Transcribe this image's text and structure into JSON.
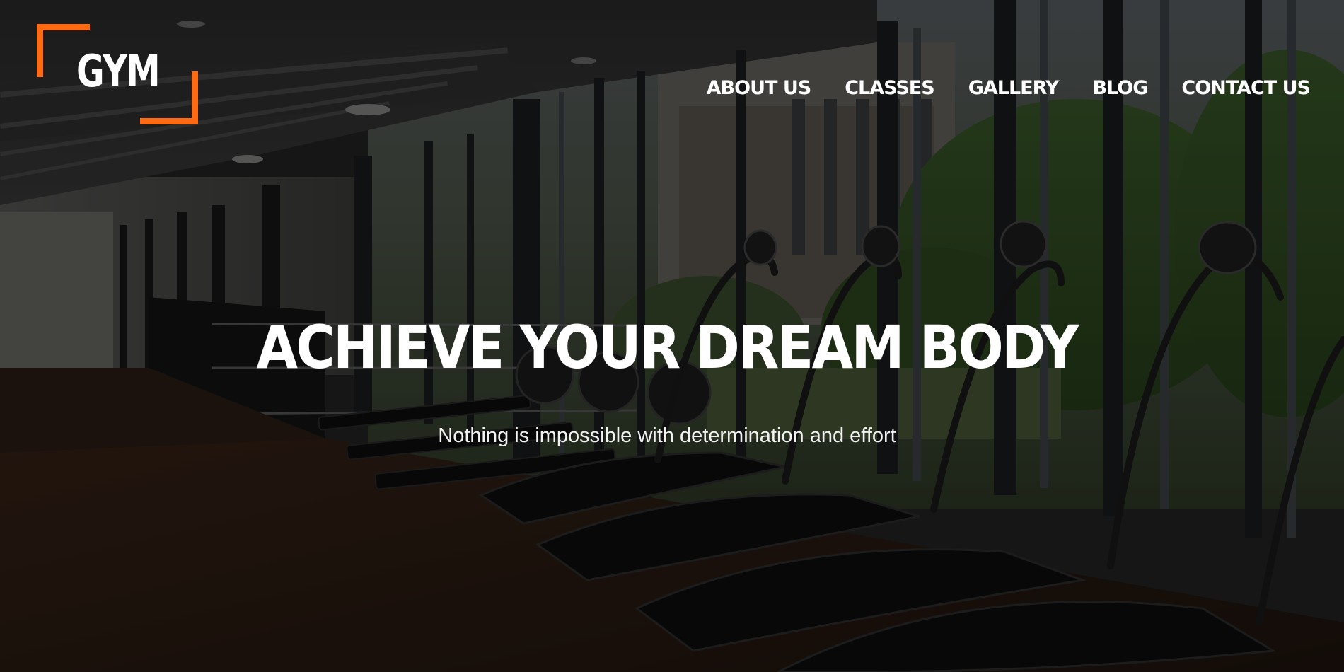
{
  "logo": {
    "text": "GYM"
  },
  "nav": {
    "items": [
      {
        "label": "ABOUT US"
      },
      {
        "label": "CLASSES"
      },
      {
        "label": "GALLERY"
      },
      {
        "label": "BLOG"
      },
      {
        "label": "CONTACT US"
      }
    ]
  },
  "hero": {
    "title": "ACHIEVE YOUR DREAM BODY",
    "subtitle": "Nothing is impossible with determination and effort"
  },
  "colors": {
    "accent": "#ff6a13",
    "text": "#ffffff"
  },
  "icons": {
    "logo_frame": "orange-corner-brackets",
    "background": "gym-treadmills-photo"
  }
}
